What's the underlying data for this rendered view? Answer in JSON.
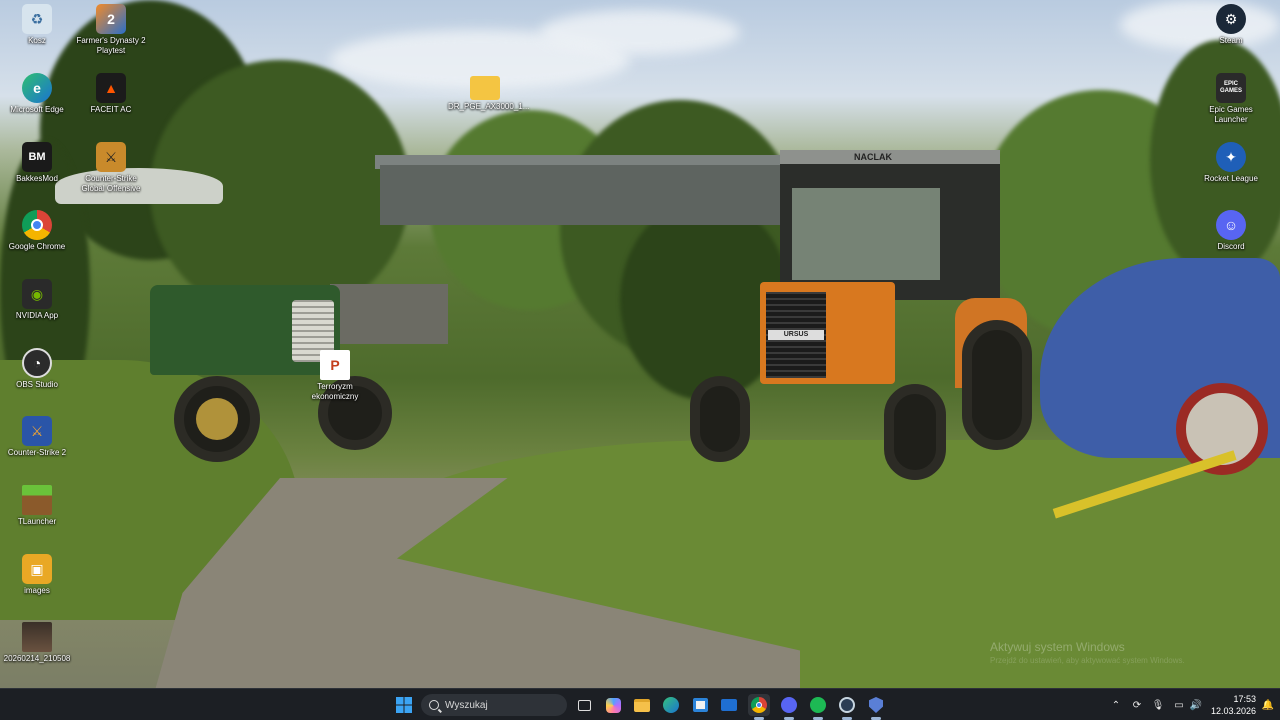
{
  "desktop": {
    "left_icons": [
      {
        "label": "Kosz",
        "icon": "recycle-bin-icon"
      },
      {
        "label": "Microsoft Edge",
        "icon": "edge-icon"
      },
      {
        "label": "BakkesMod",
        "icon": "bakkesmod-icon"
      },
      {
        "label": "Google Chrome",
        "icon": "chrome-icon"
      },
      {
        "label": "NVIDIA App",
        "icon": "nvidia-icon"
      },
      {
        "label": "OBS Studio",
        "icon": "obs-icon"
      },
      {
        "label": "Counter-Strike 2",
        "icon": "cs2-icon"
      },
      {
        "label": "TLauncher",
        "icon": "tlauncher-icon"
      },
      {
        "label": "images",
        "icon": "folder-image-icon"
      },
      {
        "label": "20260214_210508",
        "icon": "photo-icon"
      }
    ],
    "second_column_icons": [
      {
        "label": "Farmer's Dynasty 2 Playtest",
        "icon": "farmers-dynasty-icon"
      },
      {
        "label": "FACEIT AC",
        "icon": "faceit-icon"
      },
      {
        "label": "Counter-Strike Global Offensive",
        "icon": "csgo-icon"
      }
    ],
    "middle_icons": [
      {
        "label": "DR_PGE_AX3000_1...",
        "icon": "folder-icon"
      },
      {
        "label": "Terroryzm ekonomiczny",
        "icon": "powerpoint-icon"
      }
    ],
    "right_icons": [
      {
        "label": "Steam",
        "icon": "steam-icon"
      },
      {
        "label": "Epic Games Launcher",
        "icon": "epic-games-icon",
        "badge": "EPIC GAMES"
      },
      {
        "label": "Rocket League",
        "icon": "rocket-league-icon"
      },
      {
        "label": "Discord",
        "icon": "discord-icon"
      }
    ],
    "wallpaper_text": {
      "tractor_badge": "NACLAK",
      "grille_label": "URSUS"
    },
    "activation_watermark": {
      "title": "Aktywuj system Windows",
      "subtitle": "Przejdź do ustawień, aby aktywować system Windows."
    }
  },
  "taskbar": {
    "search_placeholder": "Wyszukaj",
    "apps": [
      "start-icon",
      "task-view-icon",
      "copilot-icon",
      "file-explorer-icon",
      "edge-icon",
      "microsoft-store-icon",
      "mail-icon",
      "chrome-icon",
      "discord-icon",
      "spotify-icon",
      "steam-icon",
      "faceit-icon"
    ],
    "time": "17:53",
    "date": "12.03.2026"
  },
  "colors": {
    "taskbar": "#1c1f24",
    "accent": "#0078d4"
  }
}
